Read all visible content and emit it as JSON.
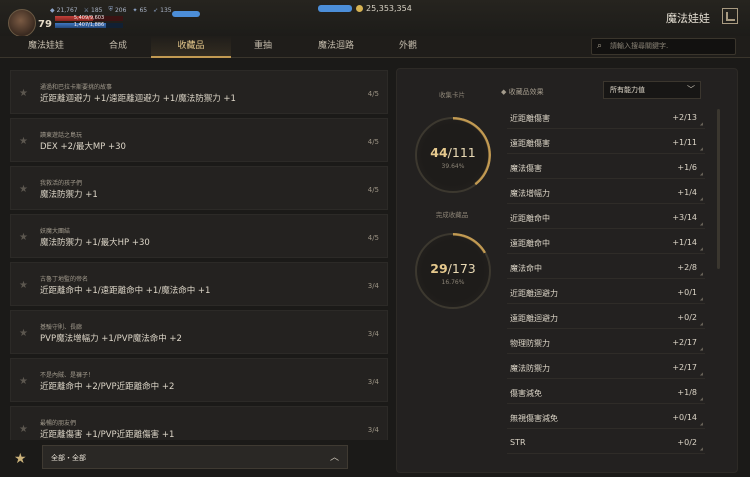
{
  "player": {
    "level": "79",
    "stats": [
      {
        "icon": "power-icon",
        "value": "21,767"
      },
      {
        "icon": "attack-icon",
        "value": "185"
      },
      {
        "icon": "defense-icon",
        "value": "206"
      },
      {
        "icon": "crit-icon",
        "value": "65"
      },
      {
        "icon": "speed-icon",
        "value": "135"
      }
    ],
    "hp_label": "5,409/9,603",
    "hp_fraction": 0.56,
    "mp_label": "1,407/1,886",
    "mp_fraction": 0.75,
    "gold": "25,353,354"
  },
  "app": {
    "title": "魔法娃娃"
  },
  "tabs": [
    {
      "label": "魔法娃娃"
    },
    {
      "label": "合成"
    },
    {
      "label": "收藏品",
      "active": true
    },
    {
      "label": "重抽"
    },
    {
      "label": "魔法迴路"
    },
    {
      "label": "外觀"
    }
  ],
  "search": {
    "placeholder": "請輸入搜尋關鍵字."
  },
  "collections": [
    {
      "name": "通過和巴拉卡斯要挑的故事",
      "effect": "近距離迴避力 +1/遠距離迴避力 +1/魔法防禦力 +1",
      "count": "4/5"
    },
    {
      "name": "讀東遊話之島玩",
      "effect": "DEX +2/最大MP +30",
      "count": "4/5"
    },
    {
      "name": "我救活的孩子們",
      "effect": "魔法防禦力 +1",
      "count": "4/5"
    },
    {
      "name": "妖魔大團結",
      "effect": "魔法防禦力 +1/最大HP +30",
      "count": "4/5"
    },
    {
      "name": "古魯丁地監的帝名",
      "effect": "近距離命中 +1/遠距離命中 +1/魔法命中 +1",
      "count": "3/4"
    },
    {
      "name": "基驗守則、長廊",
      "effect": "PVP魔法增幅力 +1/PVP魔法命中 +2",
      "count": "3/4"
    },
    {
      "name": "不是內賊、是褲子！",
      "effect": "近距離命中 +2/PVP近距離命中 +2",
      "count": "3/4"
    },
    {
      "name": "最暢的朋友們",
      "effect": "近距離傷害 +1/PVP近距離傷害 +1",
      "count": "3/4"
    }
  ],
  "filter": {
    "label": "全部・全部"
  },
  "summary": {
    "cards_label": "收集卡片",
    "cards_value": "44",
    "cards_total": "/111",
    "cards_pct": "39.64%",
    "cards_fraction": 0.3964,
    "completed_label": "完成收藏品",
    "completed_value": "29",
    "completed_total": "/173",
    "completed_pct": "16.76%",
    "completed_fraction": 0.1676
  },
  "effects_panel": {
    "title": "◆ 收藏品效果",
    "dropdown": "所有能力值",
    "items": [
      {
        "name": "近距離傷害",
        "value": "+2/13"
      },
      {
        "name": "遠距離傷害",
        "value": "+1/11"
      },
      {
        "name": "魔法傷害",
        "value": "+1/6"
      },
      {
        "name": "魔法增幅力",
        "value": "+1/4"
      },
      {
        "name": "近距離命中",
        "value": "+3/14"
      },
      {
        "name": "遠距離命中",
        "value": "+1/14"
      },
      {
        "name": "魔法命中",
        "value": "+2/8"
      },
      {
        "name": "近距離迴避力",
        "value": "+0/1"
      },
      {
        "name": "遠距離迴避力",
        "value": "+0/2"
      },
      {
        "name": "物理防禦力",
        "value": "+2/17"
      },
      {
        "name": "魔法防禦力",
        "value": "+2/17"
      },
      {
        "name": "傷害減免",
        "value": "+1/8"
      },
      {
        "name": "無視傷害減免",
        "value": "+0/14"
      },
      {
        "name": "STR",
        "value": "+0/2"
      }
    ]
  },
  "colors": {
    "accent": "#c29a52",
    "gold_text": "#e6c98d"
  }
}
